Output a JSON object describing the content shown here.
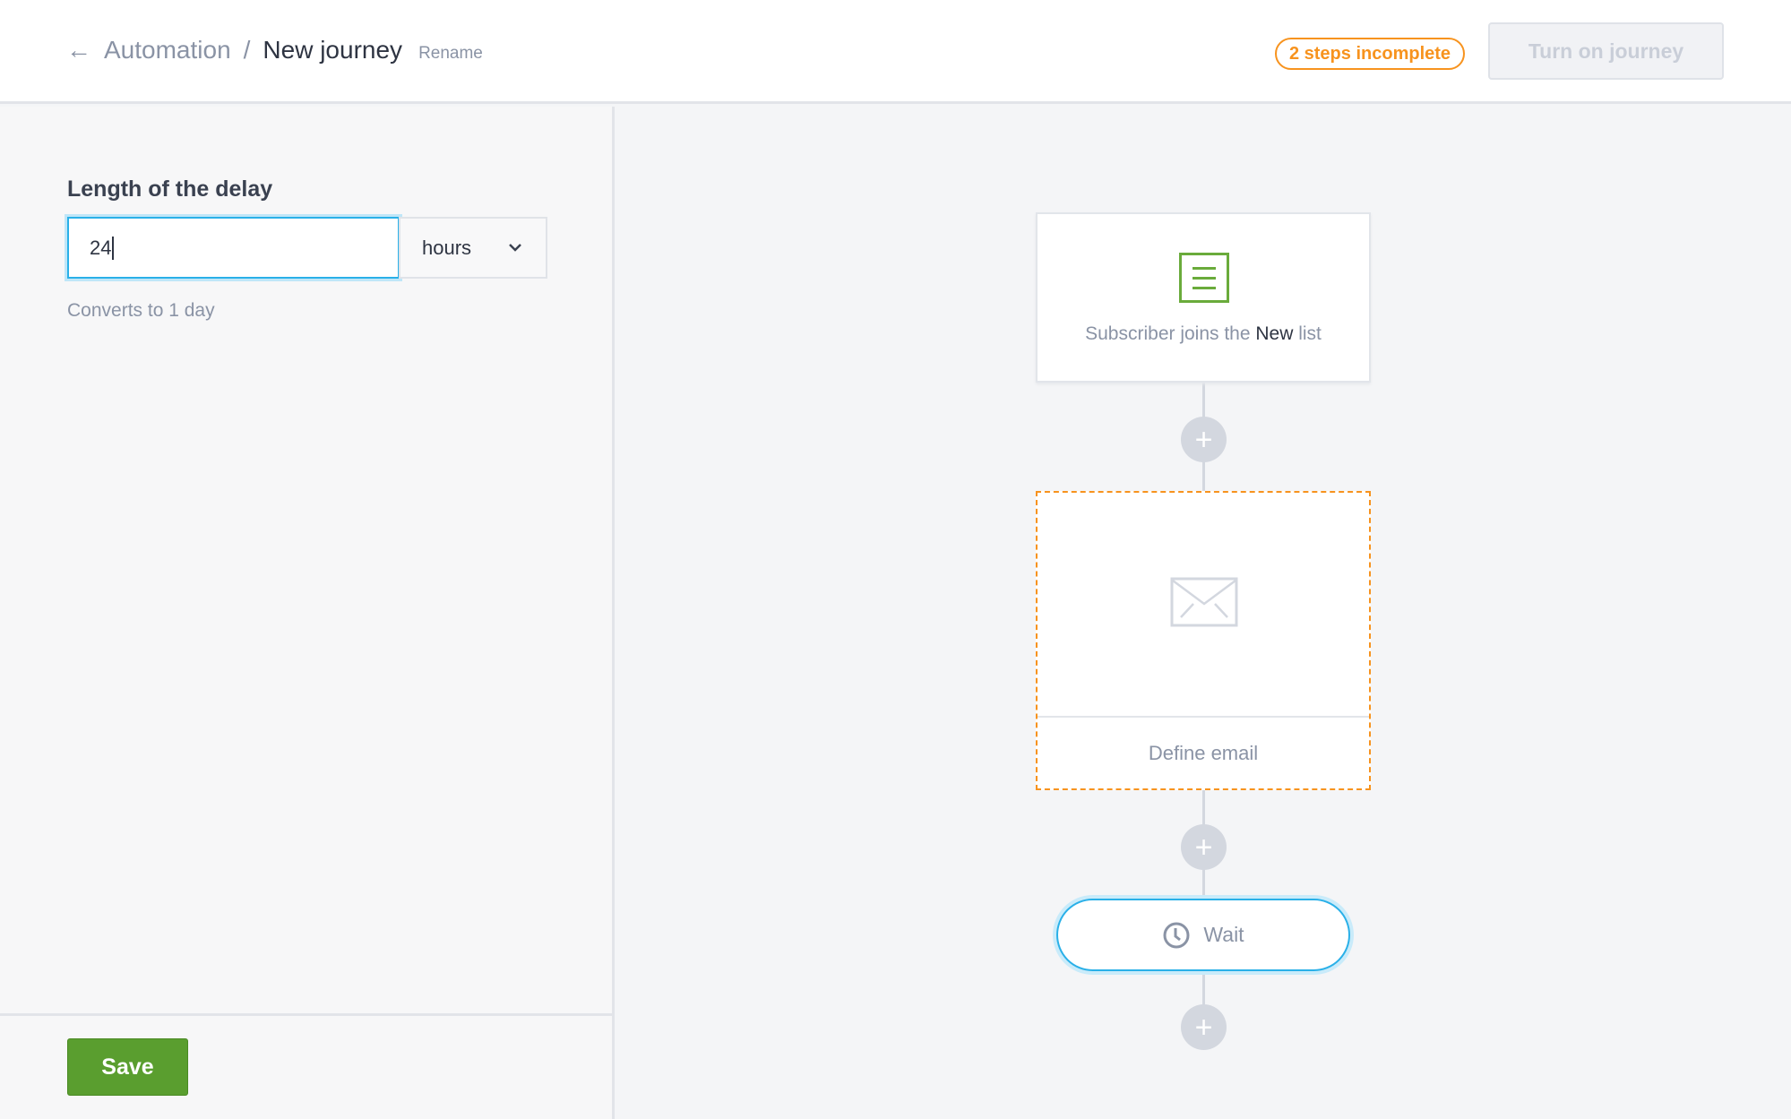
{
  "header": {
    "back_icon": "arrow-left-icon",
    "breadcrumb_parent": "Automation",
    "breadcrumb_separator": "/",
    "breadcrumb_current": "New journey",
    "rename_label": "Rename",
    "status_badge": "2 steps incomplete",
    "turn_on_label": "Turn on journey"
  },
  "panel": {
    "label": "Length of the delay",
    "delay_value": "24",
    "unit_selected": "hours",
    "converts_text": "Converts to 1 day",
    "save_label": "Save"
  },
  "canvas": {
    "trigger": {
      "prefix": "Subscriber joins the ",
      "list_name": "New",
      "suffix": " list",
      "icon": "list-icon"
    },
    "email_step": {
      "label": "Define email",
      "icon": "envelope-icon"
    },
    "wait_step": {
      "label": "Wait",
      "icon": "clock-icon"
    },
    "add_step_symbol": "+"
  },
  "colors": {
    "accent": "#2ab0e8",
    "warning": "#f7931e",
    "save": "#5a9e2f",
    "trigger_icon": "#6aab3b"
  }
}
